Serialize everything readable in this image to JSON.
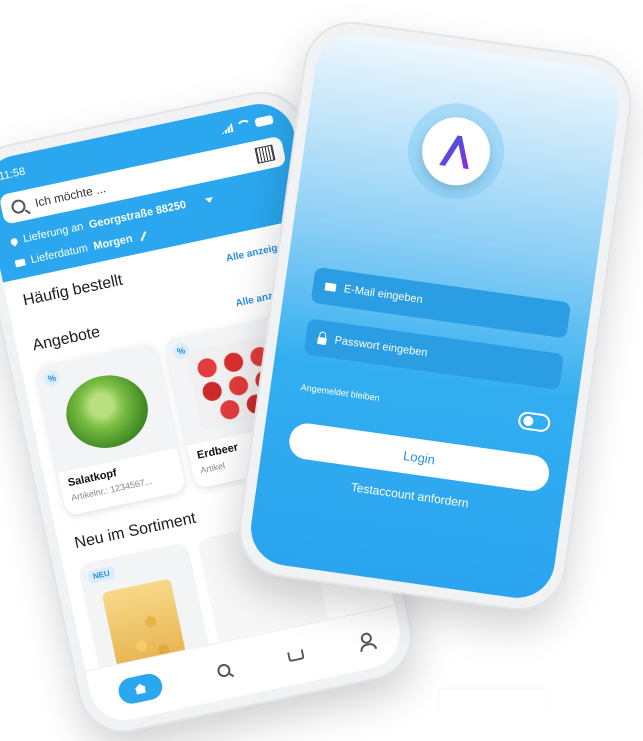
{
  "shop_phone": {
    "status": {
      "time": "11:58"
    },
    "search": {
      "placeholder": "Ich möchte ..."
    },
    "delivery": {
      "label": "Lieferung an",
      "address": "Georgstraße 88250"
    },
    "date": {
      "label": "Lieferdatum",
      "value": "Morgen"
    },
    "frequent": {
      "title": "Häufig bestellt",
      "link": "Alle anzeigen"
    },
    "offers": {
      "title": "Angebote",
      "link": "Alle anzeigen",
      "items": [
        {
          "badge": "%",
          "name": "Salatkopf",
          "article": "Artikelnr.: 1234567..."
        },
        {
          "badge": "%",
          "name": "Erdbeer",
          "article": "Artikel"
        }
      ]
    },
    "new": {
      "title": "Neu im Sortiment",
      "badge": "NEU"
    },
    "nav": {
      "items": [
        {
          "icon": "home-icon"
        },
        {
          "icon": "search-icon"
        },
        {
          "icon": "cart-icon"
        },
        {
          "icon": "user-icon"
        }
      ]
    }
  },
  "login_phone": {
    "email_placeholder": "E-Mail eingeben",
    "password_placeholder": "Passwort eingeben",
    "remember_label": "Angemeldet bleiben",
    "login_button": "Login",
    "test_account_link": "Testaccount anfordern"
  },
  "colors": {
    "accent": "#2aa7ee",
    "link": "#2a8fe0",
    "logo_gradient_start": "#3b5fd6",
    "logo_gradient_end": "#8a2be2"
  }
}
